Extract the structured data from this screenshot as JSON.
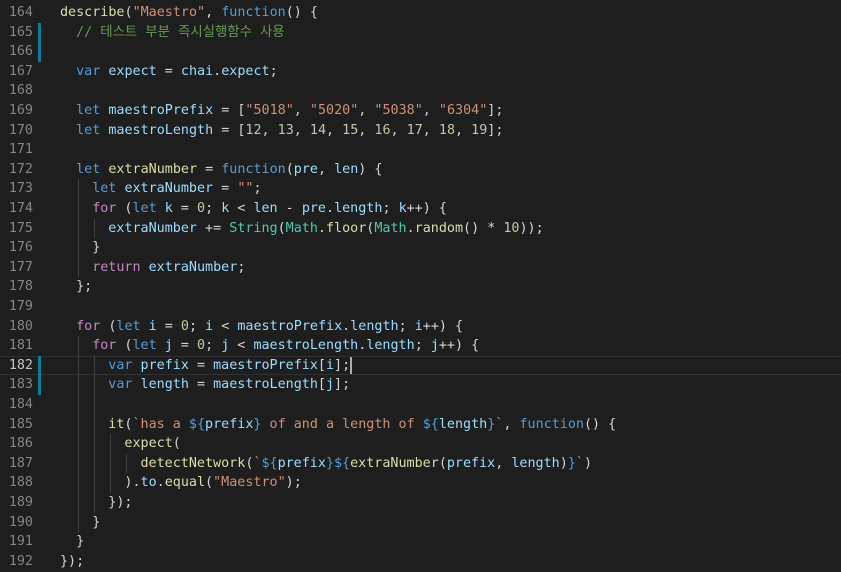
{
  "colors": {
    "background": "#1e1e1e",
    "line_number": "#858585",
    "line_number_active": "#c6c6c6",
    "default": "#d4d4d4",
    "keyword": "#569cd6",
    "control": "#c586c0",
    "variable": "#9cdcfe",
    "function": "#dcdcaa",
    "string": "#ce9178",
    "number": "#b5cea8",
    "comment": "#6a9955",
    "type": "#4ec9b0",
    "modified_marker": "#0c7d9d"
  },
  "editor": {
    "active_line": 182,
    "lines": [
      {
        "n": 164,
        "indent": 0,
        "tokens": [
          [
            "describe",
            "f"
          ],
          [
            "(",
            "d"
          ],
          [
            "\"Maestro\"",
            "s"
          ],
          [
            ", ",
            "d"
          ],
          [
            "function",
            "k"
          ],
          [
            "() {",
            "d"
          ]
        ]
      },
      {
        "n": 165,
        "indent": 1,
        "mod": true,
        "tokens": [
          [
            "// 테스트 부분 즉시실행함수 사용",
            "c"
          ]
        ]
      },
      {
        "n": 166,
        "indent": 1,
        "mod": true,
        "tokens": []
      },
      {
        "n": 167,
        "indent": 1,
        "tokens": [
          [
            "var",
            "k"
          ],
          [
            " ",
            "d"
          ],
          [
            "expect",
            "v"
          ],
          [
            " = ",
            "d"
          ],
          [
            "chai",
            "v"
          ],
          [
            ".",
            "d"
          ],
          [
            "expect",
            "v"
          ],
          [
            ";",
            "d"
          ]
        ]
      },
      {
        "n": 168,
        "indent": 1,
        "tokens": []
      },
      {
        "n": 169,
        "indent": 1,
        "tokens": [
          [
            "let",
            "k"
          ],
          [
            " ",
            "d"
          ],
          [
            "maestroPrefix",
            "v"
          ],
          [
            " = [",
            "d"
          ],
          [
            "\"5018\"",
            "s"
          ],
          [
            ", ",
            "d"
          ],
          [
            "\"5020\"",
            "s"
          ],
          [
            ", ",
            "d"
          ],
          [
            "\"5038\"",
            "s"
          ],
          [
            ", ",
            "d"
          ],
          [
            "\"6304\"",
            "s"
          ],
          [
            "];",
            "d"
          ]
        ]
      },
      {
        "n": 170,
        "indent": 1,
        "tokens": [
          [
            "let",
            "k"
          ],
          [
            " ",
            "d"
          ],
          [
            "maestroLength",
            "v"
          ],
          [
            " = [",
            "d"
          ],
          [
            "12",
            "n"
          ],
          [
            ", ",
            "d"
          ],
          [
            "13",
            "n"
          ],
          [
            ", ",
            "d"
          ],
          [
            "14",
            "n"
          ],
          [
            ", ",
            "d"
          ],
          [
            "15",
            "n"
          ],
          [
            ", ",
            "d"
          ],
          [
            "16",
            "n"
          ],
          [
            ", ",
            "d"
          ],
          [
            "17",
            "n"
          ],
          [
            ", ",
            "d"
          ],
          [
            "18",
            "n"
          ],
          [
            ", ",
            "d"
          ],
          [
            "19",
            "n"
          ],
          [
            "];",
            "d"
          ]
        ]
      },
      {
        "n": 171,
        "indent": 1,
        "tokens": []
      },
      {
        "n": 172,
        "indent": 1,
        "tokens": [
          [
            "let",
            "k"
          ],
          [
            " ",
            "d"
          ],
          [
            "extraNumber",
            "f"
          ],
          [
            " = ",
            "d"
          ],
          [
            "function",
            "k"
          ],
          [
            "(",
            "d"
          ],
          [
            "pre",
            "v"
          ],
          [
            ", ",
            "d"
          ],
          [
            "len",
            "v"
          ],
          [
            ") {",
            "d"
          ]
        ]
      },
      {
        "n": 173,
        "indent": 2,
        "tokens": [
          [
            "let",
            "k"
          ],
          [
            " ",
            "d"
          ],
          [
            "extraNumber",
            "v"
          ],
          [
            " = ",
            "d"
          ],
          [
            "\"\"",
            "s"
          ],
          [
            ";",
            "d"
          ]
        ]
      },
      {
        "n": 174,
        "indent": 2,
        "tokens": [
          [
            "for",
            "ctl"
          ],
          [
            " (",
            "d"
          ],
          [
            "let",
            "k"
          ],
          [
            " ",
            "d"
          ],
          [
            "k",
            "v"
          ],
          [
            " = ",
            "d"
          ],
          [
            "0",
            "n"
          ],
          [
            "; ",
            "d"
          ],
          [
            "k",
            "v"
          ],
          [
            " < ",
            "d"
          ],
          [
            "len",
            "v"
          ],
          [
            " - ",
            "d"
          ],
          [
            "pre",
            "v"
          ],
          [
            ".",
            "d"
          ],
          [
            "length",
            "v"
          ],
          [
            "; ",
            "d"
          ],
          [
            "k",
            "v"
          ],
          [
            "++) {",
            "d"
          ]
        ]
      },
      {
        "n": 175,
        "indent": 3,
        "tokens": [
          [
            "extraNumber",
            "v"
          ],
          [
            " += ",
            "d"
          ],
          [
            "String",
            "t"
          ],
          [
            "(",
            "d"
          ],
          [
            "Math",
            "t"
          ],
          [
            ".",
            "d"
          ],
          [
            "floor",
            "f"
          ],
          [
            "(",
            "d"
          ],
          [
            "Math",
            "t"
          ],
          [
            ".",
            "d"
          ],
          [
            "random",
            "f"
          ],
          [
            "() * ",
            "d"
          ],
          [
            "10",
            "n"
          ],
          [
            "));",
            "d"
          ]
        ]
      },
      {
        "n": 176,
        "indent": 2,
        "tokens": [
          [
            "}",
            "d"
          ]
        ]
      },
      {
        "n": 177,
        "indent": 2,
        "tokens": [
          [
            "return",
            "ctl"
          ],
          [
            " ",
            "d"
          ],
          [
            "extraNumber",
            "v"
          ],
          [
            ";",
            "d"
          ]
        ]
      },
      {
        "n": 178,
        "indent": 1,
        "tokens": [
          [
            "};",
            "d"
          ]
        ]
      },
      {
        "n": 179,
        "indent": 1,
        "tokens": []
      },
      {
        "n": 180,
        "indent": 1,
        "tokens": [
          [
            "for",
            "ctl"
          ],
          [
            " (",
            "d"
          ],
          [
            "let",
            "k"
          ],
          [
            " ",
            "d"
          ],
          [
            "i",
            "v"
          ],
          [
            " = ",
            "d"
          ],
          [
            "0",
            "n"
          ],
          [
            "; ",
            "d"
          ],
          [
            "i",
            "v"
          ],
          [
            " < ",
            "d"
          ],
          [
            "maestroPrefix",
            "v"
          ],
          [
            ".",
            "d"
          ],
          [
            "length",
            "v"
          ],
          [
            "; ",
            "d"
          ],
          [
            "i",
            "v"
          ],
          [
            "++) {",
            "d"
          ]
        ]
      },
      {
        "n": 181,
        "indent": 2,
        "tokens": [
          [
            "for",
            "ctl"
          ],
          [
            " (",
            "d"
          ],
          [
            "let",
            "k"
          ],
          [
            " ",
            "d"
          ],
          [
            "j",
            "v"
          ],
          [
            " = ",
            "d"
          ],
          [
            "0",
            "n"
          ],
          [
            "; ",
            "d"
          ],
          [
            "j",
            "v"
          ],
          [
            " < ",
            "d"
          ],
          [
            "maestroLength",
            "v"
          ],
          [
            ".",
            "d"
          ],
          [
            "length",
            "v"
          ],
          [
            "; ",
            "d"
          ],
          [
            "j",
            "v"
          ],
          [
            "++) {",
            "d"
          ]
        ]
      },
      {
        "n": 182,
        "indent": 3,
        "mod": true,
        "tokens": [
          [
            "var",
            "k"
          ],
          [
            " ",
            "d"
          ],
          [
            "prefix",
            "v"
          ],
          [
            " = ",
            "d"
          ],
          [
            "maestroPrefix",
            "v"
          ],
          [
            "[",
            "d"
          ],
          [
            "i",
            "v"
          ],
          [
            "];",
            "d"
          ]
        ]
      },
      {
        "n": 183,
        "indent": 3,
        "mod": true,
        "tokens": [
          [
            "var",
            "k"
          ],
          [
            " ",
            "d"
          ],
          [
            "length",
            "v"
          ],
          [
            " = ",
            "d"
          ],
          [
            "maestroLength",
            "v"
          ],
          [
            "[",
            "d"
          ],
          [
            "j",
            "v"
          ],
          [
            "];",
            "d"
          ]
        ]
      },
      {
        "n": 184,
        "indent": 3,
        "tokens": []
      },
      {
        "n": 185,
        "indent": 3,
        "tokens": [
          [
            "it",
            "f"
          ],
          [
            "(",
            "d"
          ],
          [
            "`has a ",
            "s"
          ],
          [
            "${",
            "k"
          ],
          [
            "prefix",
            "v"
          ],
          [
            "}",
            "k"
          ],
          [
            " of and a length of ",
            "s"
          ],
          [
            "${",
            "k"
          ],
          [
            "length",
            "v"
          ],
          [
            "}",
            "k"
          ],
          [
            "`",
            "s"
          ],
          [
            ", ",
            "d"
          ],
          [
            "function",
            "k"
          ],
          [
            "() {",
            "d"
          ]
        ]
      },
      {
        "n": 186,
        "indent": 4,
        "tokens": [
          [
            "expect",
            "f"
          ],
          [
            "(",
            "d"
          ]
        ]
      },
      {
        "n": 187,
        "indent": 5,
        "tokens": [
          [
            "detectNetwork",
            "f"
          ],
          [
            "(",
            "d"
          ],
          [
            "`",
            "s"
          ],
          [
            "${",
            "k"
          ],
          [
            "prefix",
            "v"
          ],
          [
            "}",
            "k"
          ],
          [
            "${",
            "k"
          ],
          [
            "extraNumber",
            "f"
          ],
          [
            "(",
            "d"
          ],
          [
            "prefix",
            "v"
          ],
          [
            ", ",
            "d"
          ],
          [
            "length",
            "v"
          ],
          [
            ")",
            "d"
          ],
          [
            "}",
            "k"
          ],
          [
            "`",
            "s"
          ],
          [
            ")",
            "d"
          ]
        ]
      },
      {
        "n": 188,
        "indent": 4,
        "tokens": [
          [
            ").",
            "d"
          ],
          [
            "to",
            "v"
          ],
          [
            ".",
            "d"
          ],
          [
            "equal",
            "f"
          ],
          [
            "(",
            "d"
          ],
          [
            "\"Maestro\"",
            "s"
          ],
          [
            ");",
            "d"
          ]
        ]
      },
      {
        "n": 189,
        "indent": 3,
        "tokens": [
          [
            "});",
            "d"
          ]
        ]
      },
      {
        "n": 190,
        "indent": 2,
        "tokens": [
          [
            "}",
            "d"
          ]
        ]
      },
      {
        "n": 191,
        "indent": 1,
        "tokens": [
          [
            "}",
            "d"
          ]
        ]
      },
      {
        "n": 192,
        "indent": 0,
        "tokens": [
          [
            "});",
            "d"
          ]
        ]
      }
    ]
  }
}
